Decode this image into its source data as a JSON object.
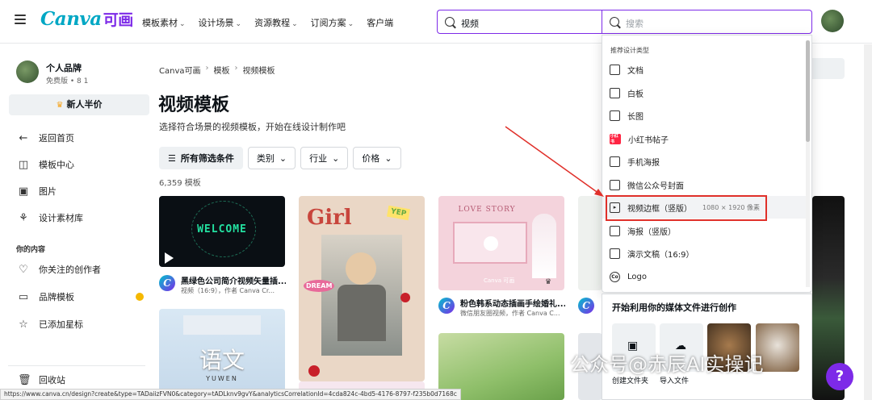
{
  "header": {
    "logo": "Canva",
    "logo_cn": "可画",
    "nav": [
      "模板素材",
      "设计场景",
      "资源教程",
      "订阅方案",
      "客户端"
    ],
    "search_value": "视频",
    "search_placeholder": "搜索"
  },
  "sidebar": {
    "profile_name": "个人品牌",
    "profile_sub": "免费版 • 8 1",
    "half_price": "新人半价",
    "items": [
      {
        "label": "返回首页",
        "icon": "arrow-left-icon"
      },
      {
        "label": "模板中心",
        "icon": "template-icon"
      },
      {
        "label": "图片",
        "icon": "image-icon"
      },
      {
        "label": "设计素材库",
        "icon": "elements-icon"
      }
    ],
    "section_title": "你的内容",
    "content_items": [
      {
        "label": "你关注的创作者",
        "icon": "heart-icon"
      },
      {
        "label": "品牌模板",
        "icon": "brand-icon"
      },
      {
        "label": "已添加星标",
        "icon": "star-icon"
      }
    ],
    "trash": "回收站"
  },
  "main": {
    "breadcrumb": [
      "Canva可画",
      "模板",
      "视频模板"
    ],
    "title": "视频模板",
    "subtitle": "选择符合场景的视频模板，开始在线设计制作吧",
    "filters": [
      "所有筛选条件",
      "类别",
      "行业",
      "价格"
    ],
    "count": "6,359 模板",
    "cards": [
      {
        "title": "黑绿色公司简介视频矢量插...",
        "meta": "视频（16:9），作者 Canva Cr...",
        "art_text": "WELCOME"
      },
      {
        "art_text": "Girl",
        "art_text2": "YEP",
        "art_text3": "DREAM"
      },
      {
        "title": "粉色韩系动态插画手绘婚礼...",
        "meta": "微信朋友圈视频，作者 Canva C...",
        "art_text": "LOVE STORY",
        "art_text2": "Canva 可画"
      },
      {
        "art_text": "语文",
        "art_text2": "YUWEN"
      }
    ]
  },
  "dropdown": {
    "header": "推荐设计类型",
    "items": [
      {
        "label": "文档",
        "icon": "doc-icon"
      },
      {
        "label": "白板",
        "icon": "whiteboard-icon"
      },
      {
        "label": "长图",
        "icon": "long-image-icon"
      },
      {
        "label": "小红书帖子",
        "icon": "xiaohongshu-icon",
        "badge": "小红书"
      },
      {
        "label": "手机海报",
        "icon": "phone-poster-icon"
      },
      {
        "label": "微信公众号封面",
        "icon": "wechat-cover-icon"
      },
      {
        "label": "视频边框（竖版）",
        "icon": "video-frame-icon",
        "size": "1080 × 1920 像素"
      },
      {
        "label": "海报（竖版）",
        "icon": "poster-icon"
      },
      {
        "label": "演示文稿（16:9）",
        "icon": "presentation-icon"
      },
      {
        "label": "Logo",
        "icon": "logo-icon",
        "glyph": "Co"
      }
    ],
    "media_title": "开始利用你的媒体文件进行创作",
    "media_labels": [
      "创建文件夹",
      "导入文件"
    ]
  },
  "statusbar": "https://www.canva.cn/design?create&type=TADaiizFVN0&category=tADLknv9gvY&analyticsCorrelationId=4cda824c-4bd5-4176-8797-f235b0d7168c",
  "watermark": "公众号@赤辰AI实操记",
  "colors": {
    "brand_purple": "#7d2ae8",
    "brand_teal": "#00c4cc",
    "highlight_red": "#e0302a"
  }
}
